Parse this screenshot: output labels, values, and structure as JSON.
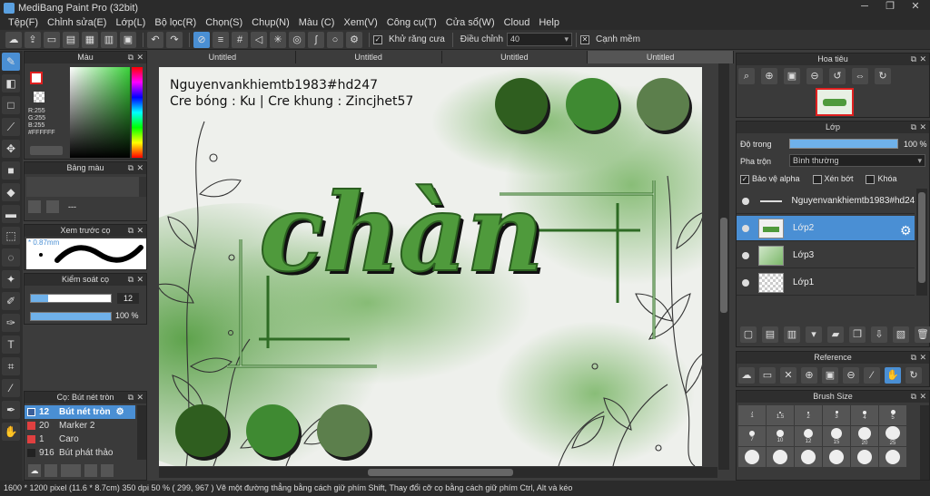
{
  "app": {
    "title": "MediBang Paint Pro (32bit)"
  },
  "menu": [
    "Tệp(F)",
    "Chỉnh sửa(E)",
    "Lớp(L)",
    "Bộ lọc(R)",
    "Chọn(S)",
    "Chụp(N)",
    "Màu (C)",
    "Xem(V)",
    "Công cụ(T)",
    "Cửa sổ(W)",
    "Cloud",
    "Help"
  ],
  "toolbar": {
    "antialias_label": "Khử răng cưa",
    "correction_label": "Điều chỉnh",
    "correction_value": "40",
    "edge_label": "Cạnh mềm"
  },
  "panels": {
    "color": {
      "title": "Màu",
      "r": "R:255",
      "g": "G:255",
      "b": "B:255",
      "hex": "#FFFFFF"
    },
    "palette": {
      "title": "Bảng màu",
      "value": "---"
    },
    "preview": {
      "title": "Xem trước cọ",
      "size": "0.87mm"
    },
    "brush_control": {
      "title": "Kiểm soát cọ",
      "size": "12",
      "opacity": "100 %"
    },
    "brush_list": {
      "title": "Cọ: Bút nét tròn",
      "items": [
        {
          "size": "12",
          "name": "Bút nét tròn",
          "color": "#3a5f9a"
        },
        {
          "size": "20",
          "name": "Marker 2",
          "color": "#e04040"
        },
        {
          "size": "1",
          "name": "Caro",
          "color": "#e04040"
        },
        {
          "size": "916",
          "name": "Bút phát thảo",
          "color": "#222222"
        }
      ]
    },
    "navigator": {
      "title": "Hoa tiêu"
    },
    "layers": {
      "title": "Lớp",
      "opacity_label": "Độ trong",
      "opacity_value": "100 %",
      "blend_label": "Pha trộn",
      "blend_value": "Bình thường",
      "protect_alpha": "Bảo vệ alpha",
      "clip": "Xén bớt",
      "lock": "Khóa",
      "items": [
        {
          "name": "Nguyenvankhiemtb1983#hd247"
        },
        {
          "name": "Lớp2"
        },
        {
          "name": "Lớp3"
        },
        {
          "name": "Lớp1"
        }
      ]
    },
    "reference": {
      "title": "Reference"
    },
    "brush_size": {
      "title": "Brush Size",
      "row1": [
        "1",
        "1.5",
        "2",
        "3",
        "4",
        "5"
      ],
      "row2": [
        "7",
        "10",
        "12",
        "15",
        "20",
        "25"
      ]
    }
  },
  "tabs": [
    "Untitled",
    "Untitled",
    "Untitled",
    "Untitled"
  ],
  "canvas": {
    "credit1": "Nguyenvankhiemtb1983#hd247",
    "credit2": "Cre bóng : Ku | Cre khung : Zincjhet57",
    "word": "chàn",
    "swatches_top": [
      "#2f5e1f",
      "#3f8a32",
      "#5c7f4c"
    ],
    "swatches_bottom": [
      "#2f5e1f",
      "#3f8a32",
      "#5c7f4c"
    ]
  },
  "status": "1600 * 1200 pixel  (11.6 * 8.7cm)  350 dpi  50 %  ( 299, 967 )  Vẽ một đường thẳng bằng cách giữ phím Shift, Thay đổi cỡ cọ bằng cách giữ phím Ctrl, Alt và kéo"
}
